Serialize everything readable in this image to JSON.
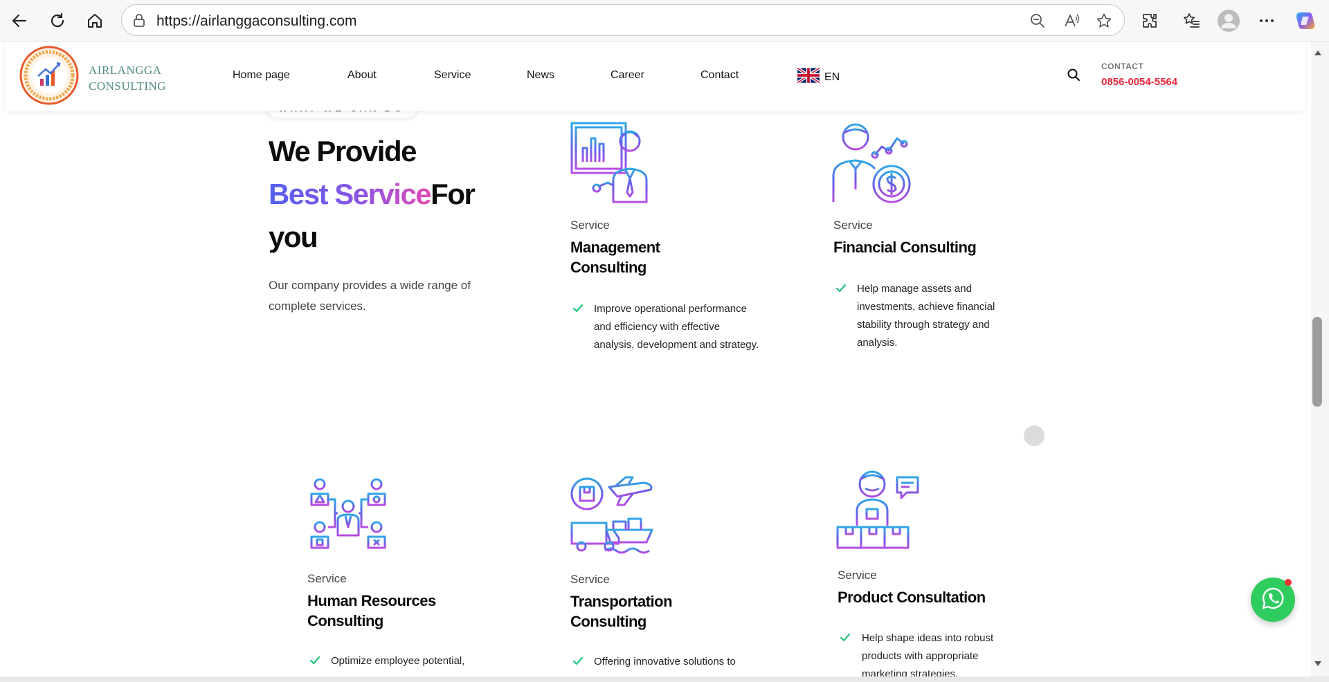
{
  "browser": {
    "url": "https://airlanggaconsulting.com"
  },
  "site": {
    "logo_line1": "AIRLANGGA",
    "logo_line2": "CONSULTING",
    "menu": [
      "Home page",
      "About",
      "Service",
      "News",
      "Career",
      "Contact"
    ],
    "language": "EN",
    "contact_label": "CONTACT",
    "contact_phone": "0856-0054-5564"
  },
  "section": {
    "tag": "WHAT WE CAN DO",
    "headline_part1": "We Provide",
    "headline_highlight": "Best Service",
    "headline_part2": "For",
    "headline_part3": "you",
    "lead": "Our company provides a wide range of complete services."
  },
  "services": [
    {
      "kicker": "Service",
      "title_line1": "Management",
      "title_line2": "Consulting",
      "desc": "Improve operational performance and efficiency with effective analysis, development and strategy.",
      "icon": "presentation-icon"
    },
    {
      "kicker": "Service",
      "title_line1": "Financial Consulting",
      "title_line2": "",
      "desc": "Help manage assets and investments, achieve financial stability through strategy and analysis.",
      "icon": "finance-icon"
    },
    {
      "kicker": "Service",
      "title_line1": "Human Resources",
      "title_line2": "Consulting",
      "desc": "Optimize employee potential,",
      "icon": "org-chart-icon"
    },
    {
      "kicker": "Service",
      "title_line1": "Transportation",
      "title_line2": "Consulting",
      "desc": "Offering innovative solutions to",
      "icon": "logistics-icon"
    },
    {
      "kicker": "Service",
      "title_line1": "Product Consultation",
      "title_line2": "",
      "desc": "Help shape ideas into robust products with appropriate marketing strategies.",
      "icon": "product-icon"
    }
  ],
  "colors": {
    "accent_gradient_start": "#5560f0",
    "accent_gradient_end": "#e24bb4",
    "check_color": "#1fc27a",
    "phone_color": "#e8283b",
    "whatsapp": "#2fcc5f"
  }
}
